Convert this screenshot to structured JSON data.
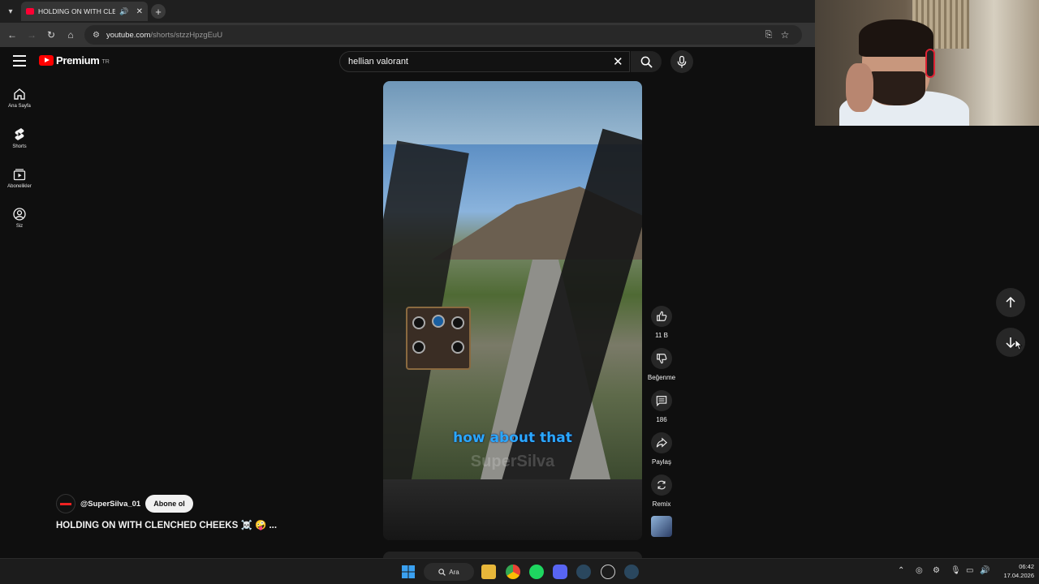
{
  "browser": {
    "tab_title": "HOLDING ON WITH CLENCHED CHEEKS",
    "url_host": "youtube.com",
    "url_path": "/shorts/stzzHpzgEuU"
  },
  "header": {
    "logo_text": "Premium",
    "logo_country": "TR",
    "search_value": "hellian valorant"
  },
  "sidebar": {
    "items": [
      {
        "label": "Ana Sayfa",
        "icon": "home-icon"
      },
      {
        "label": "Shorts",
        "icon": "shorts-icon"
      },
      {
        "label": "Abonelikler",
        "icon": "subscriptions-icon"
      },
      {
        "label": "Siz",
        "icon": "account-icon"
      }
    ]
  },
  "video": {
    "caption": "how about that",
    "watermark": "SuperSilva"
  },
  "actions": {
    "like_count": "11 B",
    "dislike_label": "Beğenme",
    "comment_count": "186",
    "share_label": "Paylaş",
    "remix_label": "Remix"
  },
  "channel": {
    "name": "@SuperSilva_01",
    "subscribe_label": "Abone ol"
  },
  "title": "HOLDING ON WITH CLENCHED CHEEKS ☠️ 🤪 ...",
  "taskbar": {
    "search_label": "Ara",
    "time": "06:42",
    "date": "17.04.2026"
  },
  "colors": {
    "youtube_red": "#ff0000",
    "caption_blue": "#2aa8ff",
    "background": "#0f0f0f"
  }
}
